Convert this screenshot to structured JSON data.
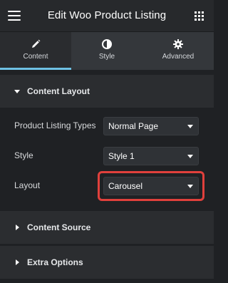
{
  "header": {
    "title": "Edit Woo Product Listing",
    "menu_icon": "hamburger-menu-icon",
    "apps_icon": "grid-apps-icon"
  },
  "tabs": [
    {
      "label": "Content",
      "icon": "pencil-icon",
      "active": true
    },
    {
      "label": "Style",
      "icon": "half-circle-contrast-icon",
      "active": false
    },
    {
      "label": "Advanced",
      "icon": "gear-icon",
      "active": false
    }
  ],
  "sections": {
    "content_layout": {
      "title": "Content Layout",
      "expanded": true
    },
    "content_source": {
      "title": "Content Source",
      "expanded": false
    },
    "extra_options": {
      "title": "Extra Options",
      "expanded": false
    }
  },
  "controls": {
    "listing_type": {
      "label": "Product Listing Types",
      "value": "Normal Page"
    },
    "style": {
      "label": "Style",
      "value": "Style 1"
    },
    "layout": {
      "label": "Layout",
      "value": "Carousel"
    }
  },
  "colors": {
    "accent": "#6ec1e4",
    "highlight": "#e0403c",
    "background": "#1f2124"
  }
}
